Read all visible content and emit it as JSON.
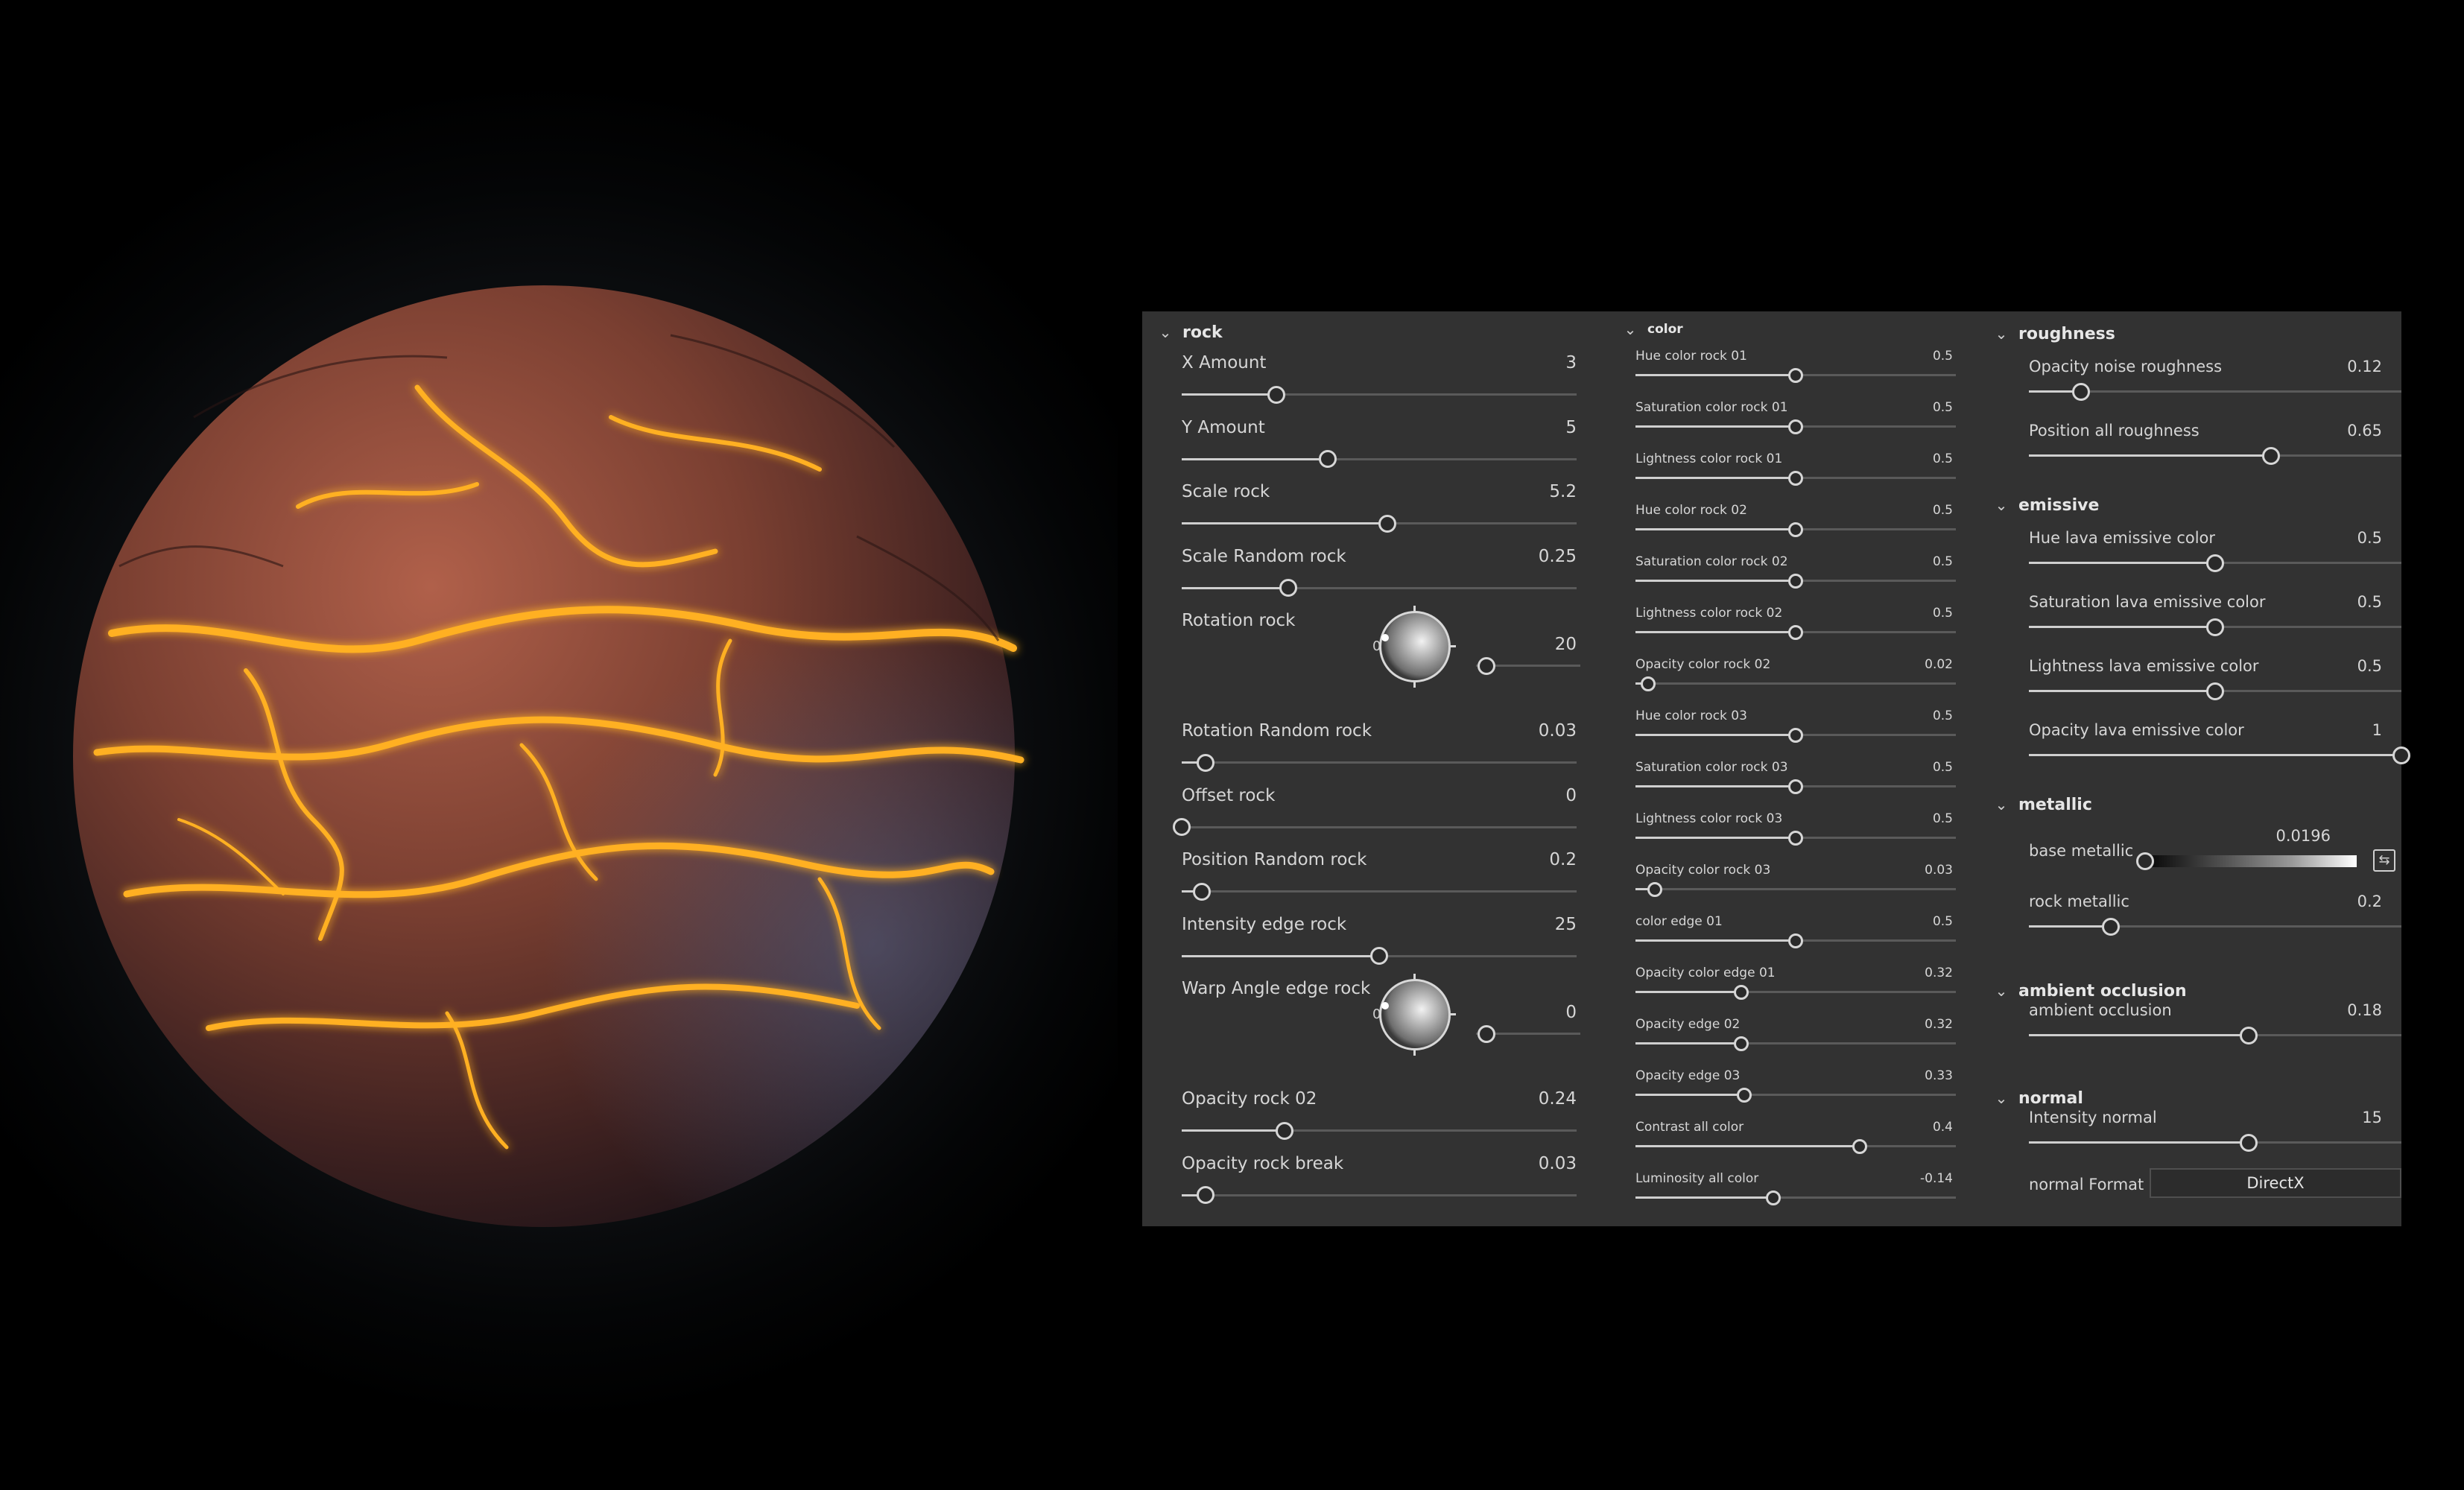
{
  "panel": {
    "rock": {
      "title": "rock",
      "params": [
        {
          "label": "X Amount",
          "value": "3",
          "fraction": 0.24
        },
        {
          "label": "Y Amount",
          "value": "5",
          "fraction": 0.37
        },
        {
          "label": "Scale rock",
          "value": "5.2",
          "fraction": 0.52
        },
        {
          "label": "Scale Random rock",
          "value": "0.25",
          "fraction": 0.27
        },
        {
          "label": "Rotation rock",
          "value": "20",
          "type": "angle"
        },
        {
          "label": "Rotation Random rock",
          "value": "0.03",
          "fraction": 0.06
        },
        {
          "label": "Offset rock",
          "value": "0",
          "fraction": 0.0
        },
        {
          "label": "Position Random rock",
          "value": "0.2",
          "fraction": 0.05
        },
        {
          "label": "Intensity edge rock",
          "value": "25",
          "fraction": 0.5
        },
        {
          "label": "Warp Angle edge rock",
          "value": "0",
          "type": "angle"
        },
        {
          "label": "Opacity rock 02",
          "value": "0.24",
          "fraction": 0.26
        },
        {
          "label": "Opacity rock break",
          "value": "0.03",
          "fraction": 0.06
        }
      ]
    },
    "color": {
      "title": "color",
      "params": [
        {
          "label": "Hue color rock 01",
          "value": "0.5",
          "fraction": 0.5
        },
        {
          "label": "Saturation color rock 01",
          "value": "0.5",
          "fraction": 0.5
        },
        {
          "label": "Lightness color rock 01",
          "value": "0.5",
          "fraction": 0.5
        },
        {
          "label": "Hue color rock 02",
          "value": "0.5",
          "fraction": 0.5
        },
        {
          "label": "Saturation color rock 02",
          "value": "0.5",
          "fraction": 0.5
        },
        {
          "label": "Lightness color rock 02",
          "value": "0.5",
          "fraction": 0.5
        },
        {
          "label": "Opacity color rock 02",
          "value": "0.02",
          "fraction": 0.04
        },
        {
          "label": "Hue color rock 03",
          "value": "0.5",
          "fraction": 0.5
        },
        {
          "label": "Saturation color rock 03",
          "value": "0.5",
          "fraction": 0.5
        },
        {
          "label": "Lightness color rock 03",
          "value": "0.5",
          "fraction": 0.5
        },
        {
          "label": "Opacity color rock 03",
          "value": "0.03",
          "fraction": 0.06
        },
        {
          "label": "color edge 01",
          "value": "0.5",
          "fraction": 0.5
        },
        {
          "label": "Opacity color edge 01",
          "value": "0.32",
          "fraction": 0.33
        },
        {
          "label": "Opacity edge 02",
          "value": "0.32",
          "fraction": 0.33
        },
        {
          "label": "Opacity edge 03",
          "value": "0.33",
          "fraction": 0.34
        },
        {
          "label": "Contrast all color",
          "value": "0.4",
          "fraction": 0.7
        },
        {
          "label": "Luminosity all color",
          "value": "-0.14",
          "fraction": 0.43
        }
      ]
    },
    "roughness": {
      "title": "roughness",
      "params": [
        {
          "label": "Opacity noise roughness",
          "value": "0.12",
          "fraction": 0.14
        },
        {
          "label": "Position all roughness",
          "value": "0.65",
          "fraction": 0.65
        }
      ]
    },
    "emissive": {
      "title": "emissive",
      "params": [
        {
          "label": "Hue lava emissive color",
          "value": "0.5",
          "fraction": 0.5
        },
        {
          "label": "Saturation lava emissive color",
          "value": "0.5",
          "fraction": 0.5
        },
        {
          "label": "Lightness lava emissive color",
          "value": "0.5",
          "fraction": 0.5
        },
        {
          "label": "Opacity lava emissive color",
          "value": "1",
          "fraction": 1.0
        }
      ]
    },
    "metallic": {
      "title": "metallic",
      "base_label": "base metallic",
      "base_value": "0.0196",
      "base_fraction": 0.02,
      "rock_label": "rock metallic",
      "rock_value": "0.2",
      "rock_fraction": 0.22
    },
    "ambient_occlusion": {
      "title": "ambient occlusion",
      "label": "ambient occlusion",
      "value": "0.18",
      "fraction": 0.59
    },
    "normal": {
      "title": "normal",
      "intensity_label": "Intensity normal",
      "intensity_value": "15",
      "intensity_fraction": 0.59,
      "format_label": "normal Format",
      "format_value": "DirectX"
    }
  },
  "icons": {
    "chevron": "chevron-down-icon",
    "dial_zero": "0",
    "link": "link-icon"
  },
  "colors": {
    "panel_bg": "#323232",
    "lava": "#ff8a1a",
    "rock": "#6b3a2c"
  }
}
